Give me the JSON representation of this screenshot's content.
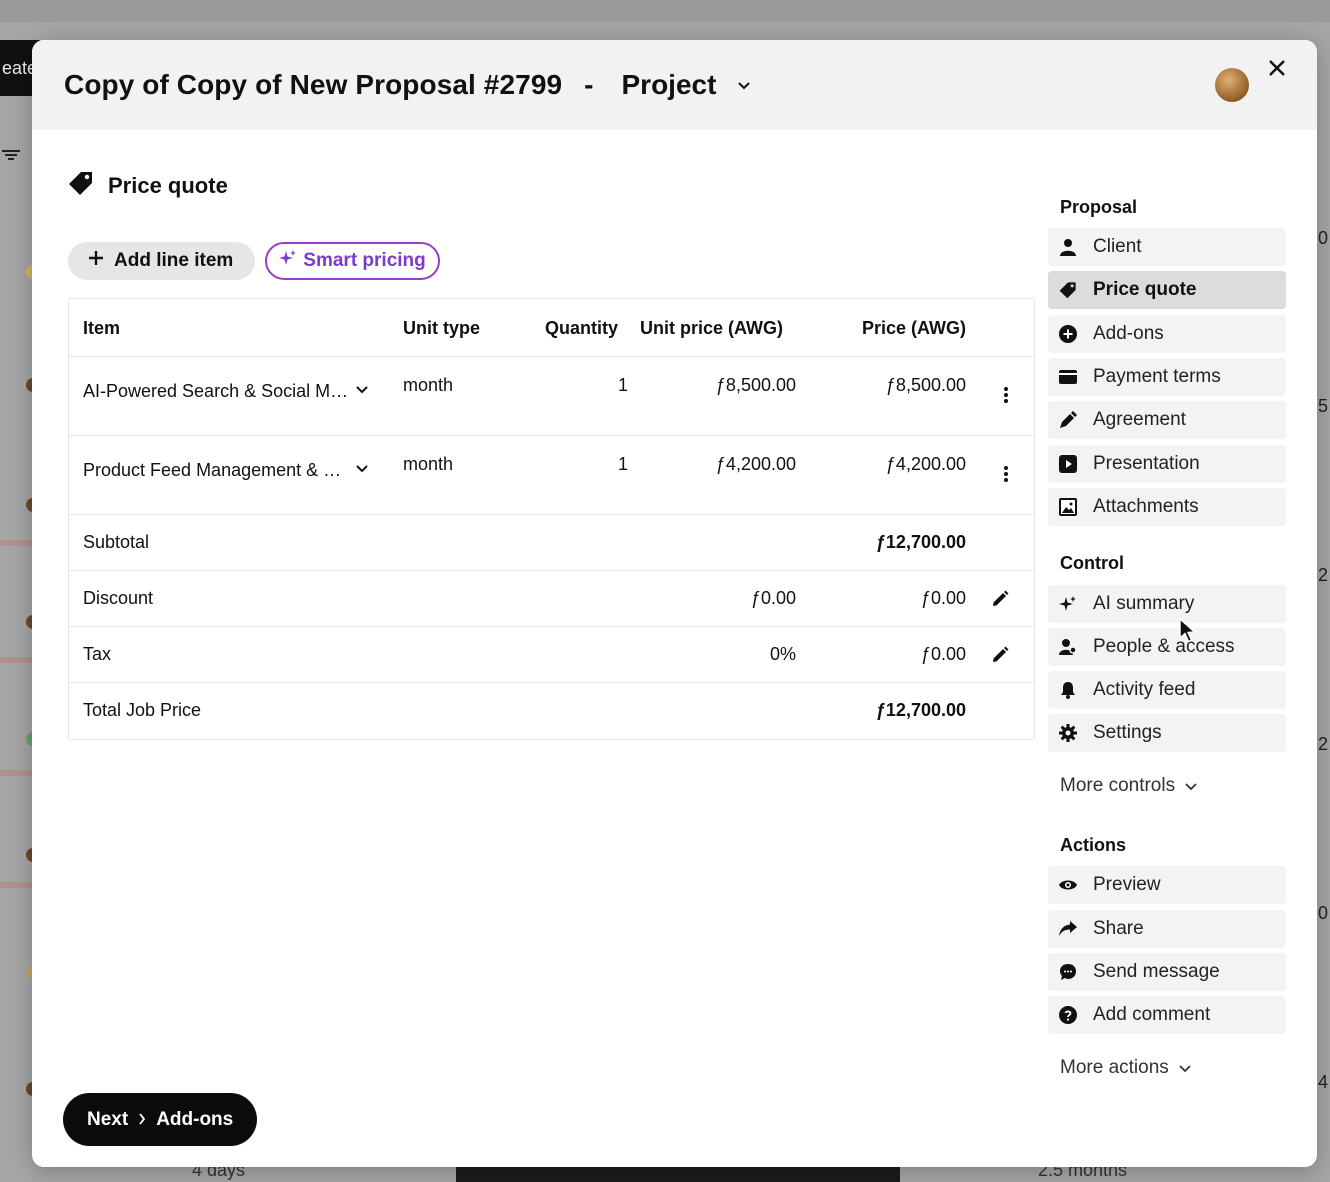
{
  "background": {
    "create_label": "eate",
    "bottom_left_text": "4 days",
    "bottom_right_text": "2.5 months",
    "edge_numbers": [
      "0",
      "5",
      "2",
      "2",
      "0",
      "4"
    ]
  },
  "header": {
    "title": "Copy of Copy of New Proposal #2799",
    "separator": "-",
    "project_label": "Project"
  },
  "section": {
    "title": "Price quote"
  },
  "buttons": {
    "add_line_item": "Add line item",
    "smart_pricing": "Smart pricing"
  },
  "table": {
    "columns": [
      "Item",
      "Unit type",
      "Quantity",
      "Unit price (AWG)",
      "Price (AWG)"
    ],
    "rows": [
      {
        "item": "AI-Powered Search & Social Media Ads Management",
        "unit_type": "month",
        "quantity": "1",
        "unit_price": "ƒ8,500.00",
        "price": "ƒ8,500.00"
      },
      {
        "item": "Product Feed Management & Optimization",
        "unit_type": "month",
        "quantity": "1",
        "unit_price": "ƒ4,200.00",
        "price": "ƒ4,200.00"
      }
    ],
    "subtotal": {
      "label": "Subtotal",
      "value": "ƒ12,700.00"
    },
    "discount": {
      "label": "Discount",
      "amount": "ƒ0.00",
      "value": "ƒ0.00"
    },
    "tax": {
      "label": "Tax",
      "rate": "0%",
      "value": "ƒ0.00"
    },
    "total": {
      "label": "Total Job Price",
      "value": "ƒ12,700.00"
    }
  },
  "sidebar": {
    "proposal_heading": "Proposal",
    "proposal_items": [
      {
        "label": "Client",
        "icon": "person-icon"
      },
      {
        "label": "Price quote",
        "icon": "tag-icon",
        "active": true
      },
      {
        "label": "Add-ons",
        "icon": "plus-circle-icon"
      },
      {
        "label": "Payment terms",
        "icon": "card-icon"
      },
      {
        "label": "Agreement",
        "icon": "pen-icon"
      },
      {
        "label": "Presentation",
        "icon": "play-icon"
      },
      {
        "label": "Attachments",
        "icon": "image-icon"
      }
    ],
    "control_heading": "Control",
    "control_items": [
      {
        "label": "AI summary",
        "icon": "sparkle-icon"
      },
      {
        "label": "People & access",
        "icon": "people-icon"
      },
      {
        "label": "Activity feed",
        "icon": "bell-icon"
      },
      {
        "label": "Settings",
        "icon": "gear-icon"
      }
    ],
    "more_controls": "More controls",
    "actions_heading": "Actions",
    "action_items": [
      {
        "label": "Preview",
        "icon": "eye-icon"
      },
      {
        "label": "Share",
        "icon": "share-icon"
      },
      {
        "label": "Send message",
        "icon": "chat-icon"
      },
      {
        "label": "Add comment",
        "icon": "question-icon"
      }
    ],
    "more_actions": "More actions"
  },
  "footer": {
    "next_label": "Next",
    "next_target": "Add-ons"
  },
  "colors": {
    "accent_purple": "#7a3ccd",
    "active_item_bg": "#dcdcde",
    "next_button_bg": "#0b0b0b"
  }
}
